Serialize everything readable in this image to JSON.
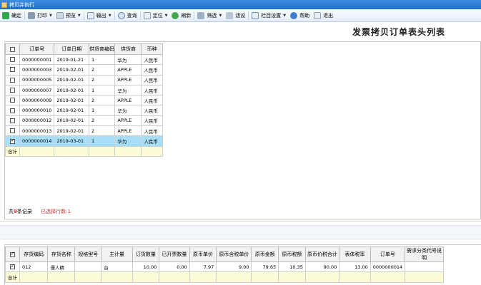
{
  "window": {
    "title": "拷贝并执行"
  },
  "toolbar": {
    "confirm": "确定",
    "print": "打印",
    "preview": "预览",
    "export": "输出",
    "query": "查询",
    "locate": "定位",
    "refresh": "刷新",
    "filter": "筛选",
    "filter_settings": "滤设",
    "column_settings": "栏目设置",
    "help": "帮助",
    "exit": "退出"
  },
  "page_title": "发票拷贝订单表头列表",
  "header_table": {
    "columns": [
      "订单号",
      "订单日期",
      "供货商编码",
      "供货商",
      "币种"
    ],
    "rows": [
      {
        "checked": false,
        "order_no": "0000000001",
        "date": "2019-01-21",
        "supplier_code": "1",
        "supplier": "华为",
        "currency": "人民币"
      },
      {
        "checked": false,
        "order_no": "0000000003",
        "date": "2019-02-01",
        "supplier_code": "2",
        "supplier": "APPLE",
        "currency": "人民币"
      },
      {
        "checked": false,
        "order_no": "0000000005",
        "date": "2019-02-01",
        "supplier_code": "2",
        "supplier": "APPLE",
        "currency": "人民币"
      },
      {
        "checked": false,
        "order_no": "0000000007",
        "date": "2019-02-01",
        "supplier_code": "1",
        "supplier": "华为",
        "currency": "人民币"
      },
      {
        "checked": false,
        "order_no": "0000000009",
        "date": "2019-02-01",
        "supplier_code": "2",
        "supplier": "APPLE",
        "currency": "人民币"
      },
      {
        "checked": false,
        "order_no": "0000000010",
        "date": "2019-02-01",
        "supplier_code": "1",
        "supplier": "华为",
        "currency": "人民币"
      },
      {
        "checked": false,
        "order_no": "0000000012",
        "date": "2019-02-01",
        "supplier_code": "2",
        "supplier": "APPLE",
        "currency": "人民币"
      },
      {
        "checked": false,
        "order_no": "0000000013",
        "date": "2019-02-01",
        "supplier_code": "2",
        "supplier": "APPLE",
        "currency": "人民币"
      },
      {
        "checked": true,
        "order_no": "0000000014",
        "date": "2019-03-01",
        "supplier_code": "1",
        "supplier": "华为",
        "currency": "人民币"
      }
    ],
    "total_label": "合计"
  },
  "status": {
    "record_prefix": "共",
    "record_count": "9",
    "record_suffix": "条记录",
    "selected_label": "已选择行数:1"
  },
  "detail_table": {
    "columns": [
      "存货编码",
      "存货名称",
      "规格型号",
      "主计量",
      "订货数量",
      "已开票数量",
      "原币单价",
      "原币含税单价",
      "原币金额",
      "原币税额",
      "原币价税合计",
      "表体税率",
      "订单号",
      "需求分类代号说明"
    ],
    "row": {
      "checked": true,
      "code": "012",
      "name": "僵人精",
      "spec": "",
      "unit": "台",
      "qty": "10.00",
      "invoiced_qty": "0.00",
      "unit_price": "7.97",
      "tax_unit_price": "9.00",
      "amount": "79.65",
      "tax": "10.35",
      "total": "90.00",
      "tax_rate": "13.00",
      "order_no": "0000000014",
      "demand_note": ""
    },
    "total_label": "合计"
  },
  "colors": {
    "titlebar": "#2a7fd6",
    "selected_row": "#a6ddf8",
    "total_row": "#fbfbd6",
    "status_red": "#d03030"
  }
}
